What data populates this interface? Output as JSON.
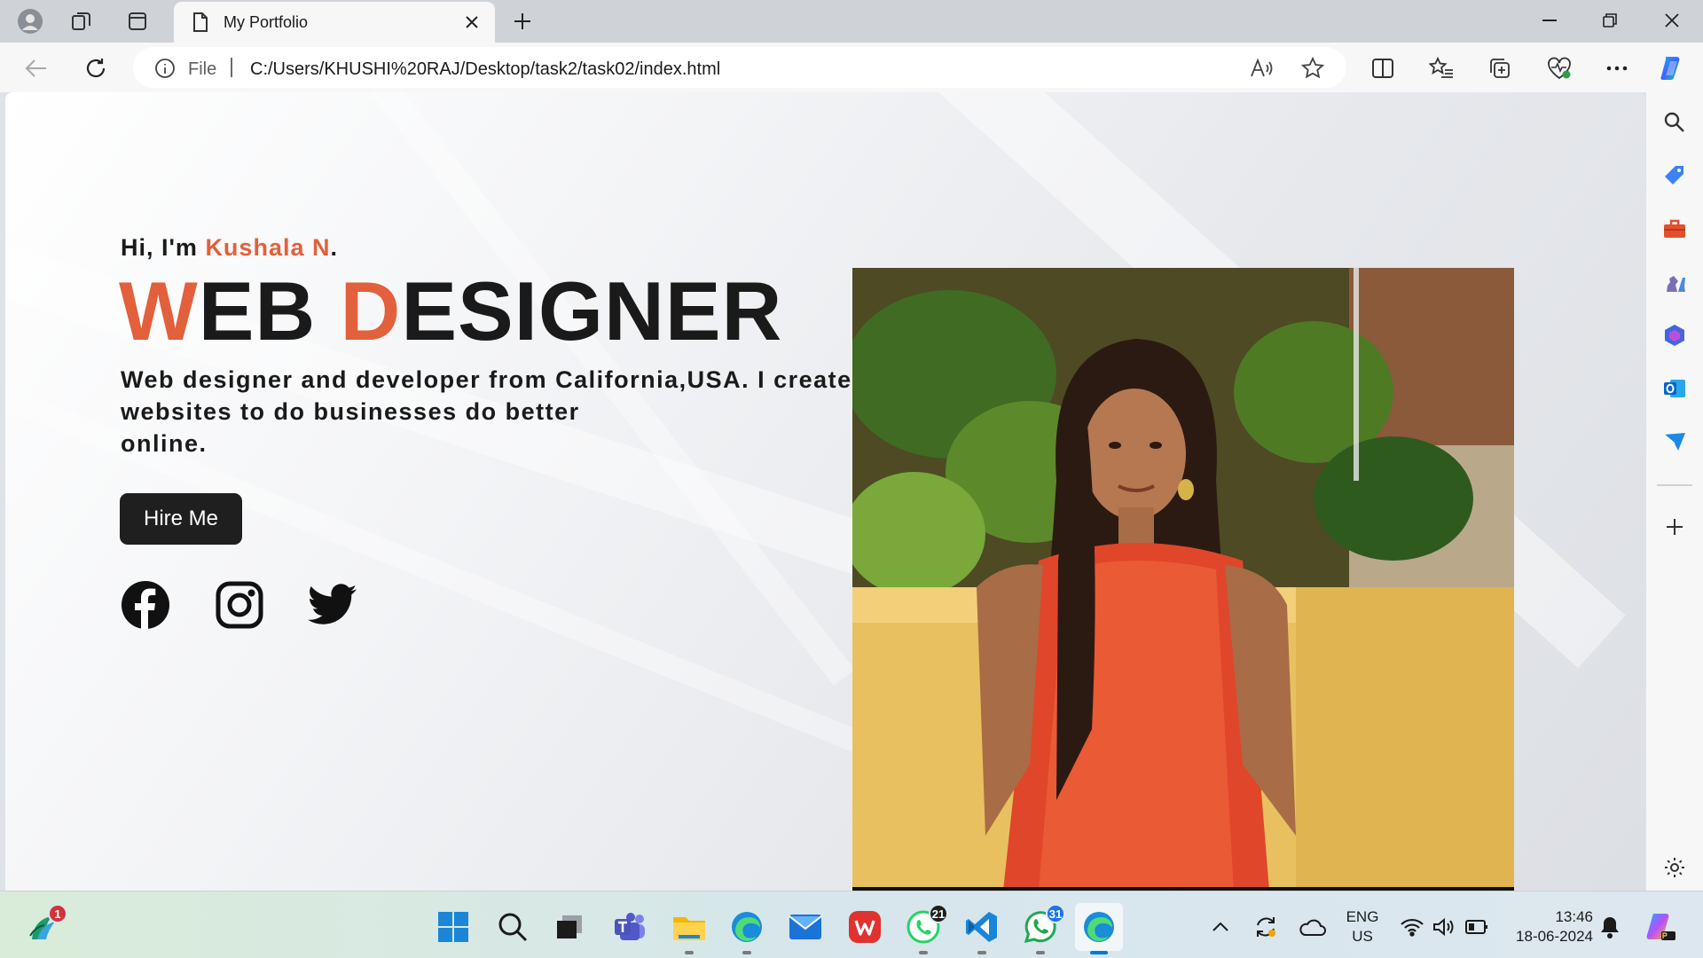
{
  "browser": {
    "tab_title": "My Portfolio",
    "address": {
      "scheme_label": "File",
      "url": "C:/Users/KHUSHI%20RAJ/Desktop/task2/task02/index.html"
    }
  },
  "page": {
    "greeting_prefix": "Hi, I'm ",
    "name": "Kushala N",
    "greeting_suffix": ".",
    "title_part1_accent": "W",
    "title_part1_rest": "EB ",
    "title_part2_accent": "D",
    "title_part2_rest": "ESIGNER",
    "description_line1": "Web designer and developer from California,USA. I create",
    "description_line2": "websites to do businesses do better",
    "description_line3": "online.",
    "hire_label": "Hire Me",
    "accent_color": "#e2603b"
  },
  "taskbar": {
    "badges": {
      "widgets": "1",
      "whatsapp_beta": "21",
      "whatsapp": "31"
    },
    "lang_line1": "ENG",
    "lang_line2": "US",
    "time": "13:46",
    "date": "18-06-2024"
  }
}
